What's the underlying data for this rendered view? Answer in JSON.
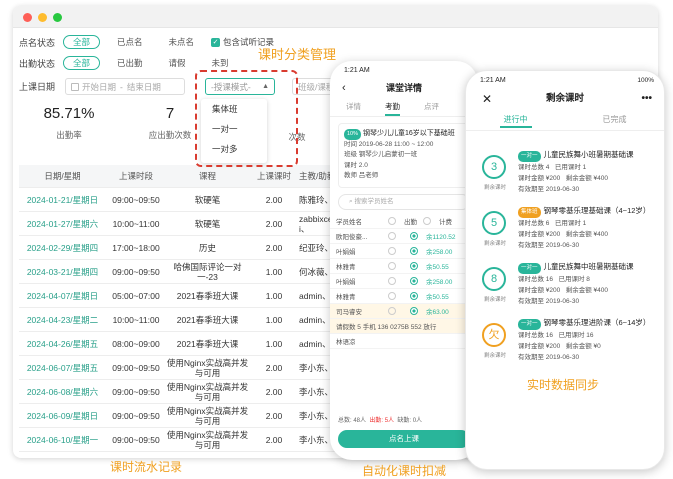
{
  "desktop": {
    "filters": {
      "attendance_state": {
        "label": "点名状态",
        "options": [
          "全部",
          "已点名",
          "未点名"
        ],
        "active": "全部",
        "checkbox_label": "包含试听记录"
      },
      "sign_state": {
        "label": "出勤状态",
        "options": [
          "全部",
          "已出勤",
          "请假",
          "未到"
        ],
        "active": "全部"
      },
      "date": {
        "label": "上课日期",
        "start_placeholder": "开始日期",
        "separator": "-",
        "end_placeholder": "结束日期"
      },
      "mode_select": {
        "placeholder": "-授课模式-"
      },
      "class_select": {
        "placeholder": "班级/课程"
      }
    },
    "mode_options": [
      "集体班",
      "一对一",
      "一对多"
    ],
    "callout": "课时分类管理",
    "stats": [
      {
        "value": "85.71%",
        "label": "出勤率"
      },
      {
        "value": "7",
        "label": "应出勤次数"
      },
      {
        "value": "",
        "label": "次数"
      }
    ],
    "table": {
      "headers": [
        "日期/星期",
        "上课时段",
        "课程",
        "上课课时",
        "主教/助教"
      ],
      "rows": [
        [
          "2024-01-21/星期日",
          "09:00~09:50",
          "软硬笔",
          "2.00",
          "陈雅玲、"
        ],
        [
          "2024-01-27/星期六",
          "10:00~11:00",
          "软硬笔",
          "2.00",
          "zabbixces i、"
        ],
        [
          "2024-02-29/星期四",
          "17:00~18:00",
          "历史",
          "2.00",
          "纪亚玲、"
        ],
        [
          "2024-03-21/星期四",
          "09:00~09:50",
          "哈佛国际评论一对一-23",
          "1.00",
          "何冰薇、"
        ],
        [
          "2024-04-07/星期日",
          "05:00~07:00",
          "2021春季班大课",
          "1.00",
          "admin、"
        ],
        [
          "2024-04-23/星期二",
          "10:00~11:00",
          "2021春季班大课",
          "1.00",
          "admin、"
        ],
        [
          "2024-04-26/星期五",
          "08:00~09:00",
          "2021春季班大课",
          "1.00",
          "admin、"
        ],
        [
          "2024-06-07/星期五",
          "09:00~09:50",
          "使用Nginx实战高并发与可用",
          "2.00",
          "李小东、"
        ],
        [
          "2024-06-08/星期六",
          "09:00~09:50",
          "使用Nginx实战高并发与可用",
          "2.00",
          "李小东、"
        ],
        [
          "2024-06-09/星期日",
          "09:00~09:50",
          "使用Nginx实战高并发与可用",
          "2.00",
          "李小东、"
        ],
        [
          "2024-06-10/星期一",
          "09:00~09:50",
          "使用Nginx实战高并发与可用",
          "2.00",
          "李小东、"
        ]
      ]
    },
    "caption": "课时流水记录"
  },
  "phone1": {
    "time": "1:21 AM",
    "battery": "100%",
    "title": "课堂详情",
    "tabs": [
      "详情",
      "考勤",
      "点评"
    ],
    "active_tab": "考勤",
    "lesson": {
      "tag": "10%",
      "name": "钢琴少儿儿童16岁以下基础班",
      "time": "时间 2019-06-28 11:00 ~ 12:00",
      "class": "班级 钢琴少儿启蒙初一班",
      "hours": "课时 2.0",
      "teacher": "教师 吕老师"
    },
    "search_placeholder": "搜索学员姓名",
    "list_header": [
      "学员姓名",
      "出勤",
      "计费"
    ],
    "students": [
      {
        "name": "欧阳俊豪...",
        "value": "余1120.52"
      },
      {
        "name": "叶娟娟",
        "value": "余258.00"
      },
      {
        "name": "林雅青",
        "value": "余50.55"
      },
      {
        "name": "叶娟娟",
        "value": "余258.00"
      },
      {
        "name": "林雅青",
        "value": "余50.55"
      },
      {
        "name": "司马睿安",
        "value": "余63.00"
      }
    ],
    "leave_line": "请假数 5   手机 136 0275B 552   放行",
    "extra_name": "林语凉",
    "footer": {
      "total": "总数: 48人",
      "present": "出勤: 5人",
      "absent": "缺勤: 0人"
    },
    "button": "点名上课",
    "caption": "自动化课时扣减"
  },
  "phone2": {
    "time": "1:21 AM",
    "battery": "100%",
    "title": "剩余课时",
    "tabs": [
      "进行中",
      "已完成"
    ],
    "active_tab": "进行中",
    "ring_label": "剩余课时",
    "courses": [
      {
        "remain": "3",
        "tag": "一对一",
        "name": "儿童民族舞小班暑期基础课",
        "total": "课时总数 4",
        "used": "已用课时 1",
        "amount": "课时金额 ¥200",
        "left": "剩余金额 ¥400",
        "valid": "有效期至 2019-06-30"
      },
      {
        "remain": "5",
        "tag": "集体班",
        "name": "钢琴零基乐理基础课（4~12岁）",
        "total": "课时总数 6",
        "used": "已用课时 1",
        "amount": "课时金额 ¥200",
        "left": "剩余金额 ¥400",
        "valid": "有效期至 2019-06-30"
      },
      {
        "remain": "8",
        "tag": "一对一",
        "name": "儿童民族舞中班暑期基础课",
        "total": "课时总数 16",
        "used": "已用课时 8",
        "amount": "课时金额 ¥200",
        "left": "剩余金额 ¥400",
        "valid": "有效期至 2019-06-30"
      },
      {
        "remain": "欠",
        "tag": "一对一",
        "name": "钢琴零基乐理进阶课（6~14岁）",
        "total": "课时总数 16",
        "used": "已用课时 16",
        "amount": "课时金额 ¥200",
        "left": "剩余金额 ¥0",
        "valid": "有效期至 2019-06-30"
      }
    ],
    "caption": "实时数据同步"
  },
  "colors": {
    "accent": "#29b59a",
    "highlight": "#f0a020",
    "alert": "#d93b2f"
  }
}
